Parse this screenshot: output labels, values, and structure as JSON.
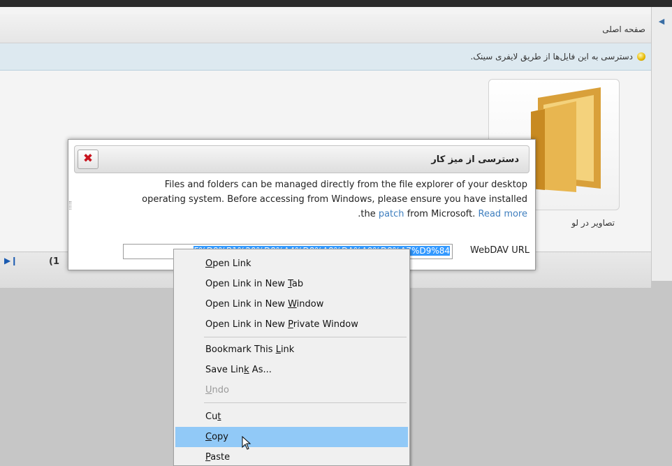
{
  "app": {
    "breadcrumb": "صفحه اصلی",
    "info": "دسترسی به این فایل‌ها از طریق لایفری سینک.",
    "folder_label": "تصاویر در لو",
    "pager_count": "(1"
  },
  "dialog": {
    "title": "دسترسی از میز کار",
    "body_line1": "Files and folders can be managed directly from the file explorer of your desktop",
    "body_line2": "operating system. Before accessing from Windows, please ensure you have installed",
    "body_line3_pre": ".the",
    "body_link_patch": "patch",
    "body_line3_mid": "from Microsoft.",
    "body_link_readmore": "Read more",
    "url_label": "WebDAV URL",
    "url_value": "F%D8%B1%20%D8%A4%D8%A8%DA%A9%D8%A7%D9%84"
  },
  "context_menu": {
    "items": [
      {
        "label": "Open Link",
        "mnemonic": "O"
      },
      {
        "label": "Open Link in New Tab",
        "mnemonic": "T"
      },
      {
        "label": "Open Link in New Window",
        "mnemonic": "W"
      },
      {
        "label": "Open Link in New Private Window",
        "mnemonic": "P"
      },
      {
        "label": "Bookmark This Link",
        "mnemonic": "L"
      },
      {
        "label": "Save Link As...",
        "mnemonic": "k"
      },
      {
        "label": "Undo",
        "mnemonic": "U"
      },
      {
        "label": "Cut",
        "mnemonic": "t"
      },
      {
        "label": "Copy",
        "mnemonic": "C"
      },
      {
        "label": "Paste",
        "mnemonic": "P"
      }
    ]
  },
  "colors": {
    "selection": "#3399ff",
    "menu_highlight": "#91c9f7",
    "link": "#3f7fbf",
    "close": "#c8141e"
  }
}
